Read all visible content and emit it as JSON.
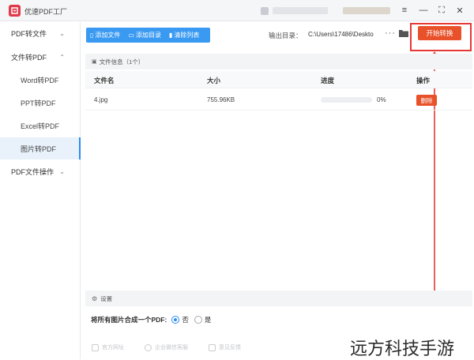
{
  "app": {
    "title": "优速PDF工厂",
    "accent": "#3a9af2",
    "action_color": "#e8512a"
  },
  "window_controls": {
    "menu": "≡",
    "minimize": "—",
    "maximize": "⛶",
    "close": "✕"
  },
  "sidebar": {
    "items": [
      {
        "label": "PDF转文件",
        "chevron": "⌄"
      },
      {
        "label": "文件转PDF",
        "chevron": "⌃"
      },
      {
        "label": "Word转PDF"
      },
      {
        "label": "PPT转PDF"
      },
      {
        "label": "Excel转PDF"
      },
      {
        "label": "图片转PDF"
      },
      {
        "label": "PDF文件操作",
        "chevron": "⌄"
      }
    ],
    "active_index": 5
  },
  "toolbar": {
    "add_file": "添加文件",
    "add_folder": "添加目录",
    "clear_list": "清除列表",
    "output_label": "输出目录：",
    "output_path": "C:\\Users\\17486\\Deskto",
    "more": "···",
    "start": "开始转换"
  },
  "file_panel": {
    "header": "文件信息（1个）",
    "columns": [
      "文件名",
      "大小",
      "进度",
      "操作"
    ],
    "rows": [
      {
        "name": "4.jpg",
        "size": "755.96KB",
        "progress_pct": 0,
        "progress_text": "0%",
        "action": "删除"
      }
    ]
  },
  "settings": {
    "header": "设置",
    "merge_question": "将所有图片合成一个PDF:",
    "options": [
      "否",
      "是"
    ],
    "selected": "否"
  },
  "footer": {
    "items": [
      "官方网址",
      "企业微信客服",
      "意见反馈"
    ]
  },
  "watermark": "远方科技手游"
}
